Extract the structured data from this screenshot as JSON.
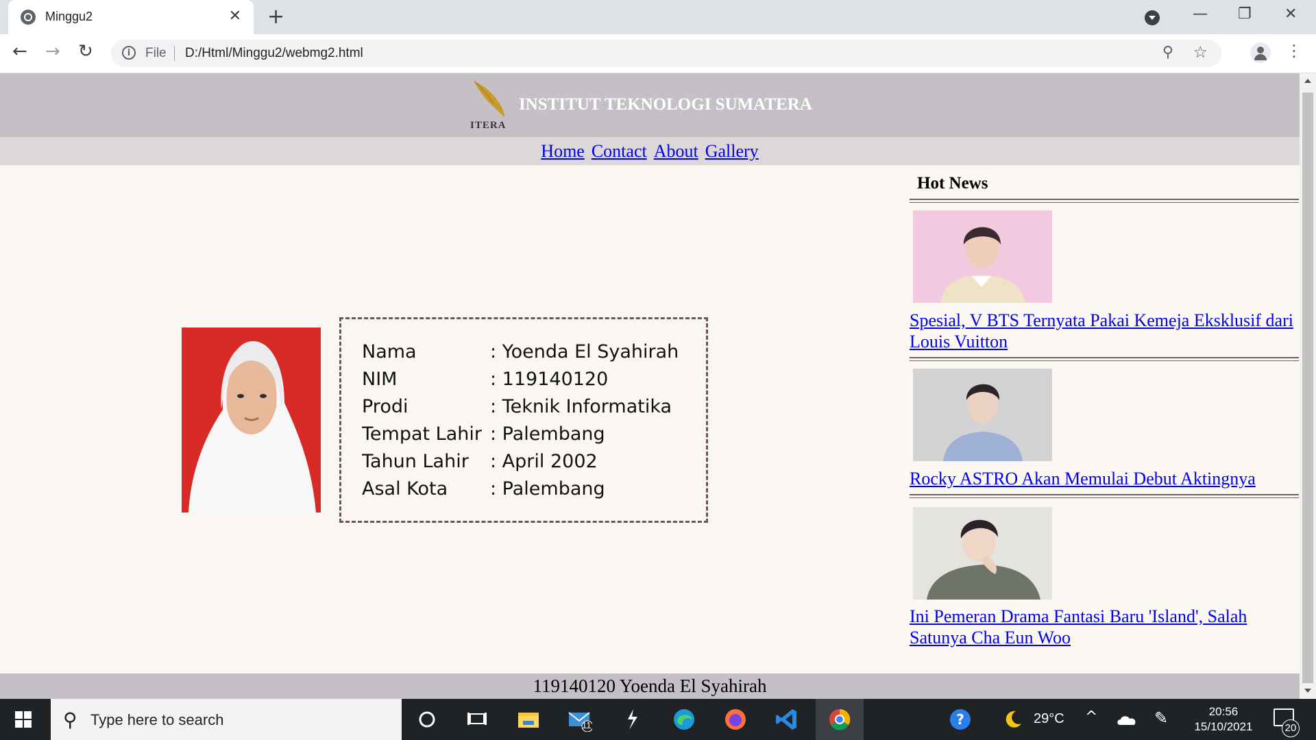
{
  "browser": {
    "tab_title": "Minggu2",
    "scheme_label": "File",
    "url": "D:/Html/Minggu2/webmg2.html"
  },
  "page": {
    "logo_label": "ITERA",
    "site_title": "INSTITUT TEKNOLOGI SUMATERA",
    "nav": [
      "Home",
      "Contact",
      "About",
      "Gallery"
    ],
    "bio": [
      {
        "label": "Nama",
        "value": ": Yoenda El Syahirah"
      },
      {
        "label": "NIM",
        "value": ": 119140120"
      },
      {
        "label": "Prodi",
        "value": ": Teknik Informatika"
      },
      {
        "label": "Tempat Lahir",
        "value": ": Palembang"
      },
      {
        "label": "Tahun Lahir",
        "value": ": April 2002"
      },
      {
        "label": "Asal Kota",
        "value": ": Palembang"
      }
    ],
    "sidebar_title": "Hot News",
    "news": [
      {
        "title": "Spesial, V BTS Ternyata Pakai Kemeja Eksklusif dari Louis Vuitton"
      },
      {
        "title": "Rocky ASTRO Akan Memulai Debut Aktingnya"
      },
      {
        "title": "Ini Pemeran Drama Fantasi Baru 'Island', Salah Satunya Cha Eun Woo"
      }
    ],
    "footer": "119140120 Yoenda El Syahirah"
  },
  "taskbar": {
    "search_placeholder": "Type here to search",
    "mail_badge": "11",
    "temperature": "29°C",
    "time": "20:56",
    "date": "15/10/2021",
    "notification_count": "20"
  },
  "colors": {
    "header_bg": "#c4c0c6",
    "nav_bg": "#dcd8da",
    "page_bg": "#fbf8f4",
    "link": "#0000ee",
    "border": "#6b5459"
  },
  "icons": [
    "globe-icon",
    "close-icon",
    "plus-icon",
    "tab-search-icon",
    "minimize-icon",
    "maximize-icon",
    "back-icon",
    "forward-icon",
    "reload-icon",
    "info-icon",
    "zoom-icon",
    "star-icon",
    "profile-icon",
    "menu-icon",
    "windows-start-icon",
    "search-icon",
    "cortana-icon",
    "task-view-icon",
    "file-explorer-icon",
    "mail-icon",
    "app-icon",
    "edge-icon",
    "firefox-icon",
    "vscode-icon",
    "chrome-icon",
    "help-icon",
    "weather-icon",
    "chevron-up-icon",
    "onedrive-icon",
    "pen-icon",
    "notification-icon"
  ]
}
